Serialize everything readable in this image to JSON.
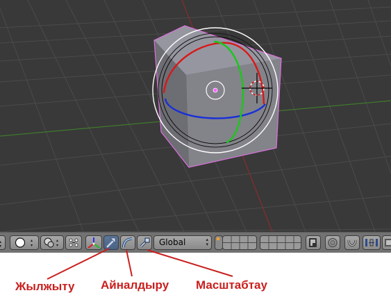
{
  "toolbar": {
    "orientation": {
      "value": "Global"
    }
  },
  "annotations": {
    "translate": "Жылжыту",
    "rotate": "Айналдыру",
    "scale": "Масштабтау",
    "color": "#c8201e"
  },
  "colors": {
    "viewport_bg": "#393939",
    "grid_line": "#4a4a4a",
    "axis_x": "#8a2a2a",
    "axis_y": "#3a7a2a",
    "selection_outline": "#e070e0",
    "gizmo_x": "#d01010",
    "gizmo_y": "#10c010",
    "gizmo_z": "#1030d0",
    "header_bg": "#727272",
    "active_button": "#5e7696"
  },
  "icons": {
    "viewport_shading": "sphere-shading-icon",
    "pivot": "pivot-point-icon",
    "manipulator_toggle": "manipulator-axes-icon",
    "translate": "translate-arrow-icon",
    "rotate": "rotate-arc-icon",
    "scale": "scale-icon",
    "snap": "magnet-icon",
    "render": "render-icon"
  }
}
